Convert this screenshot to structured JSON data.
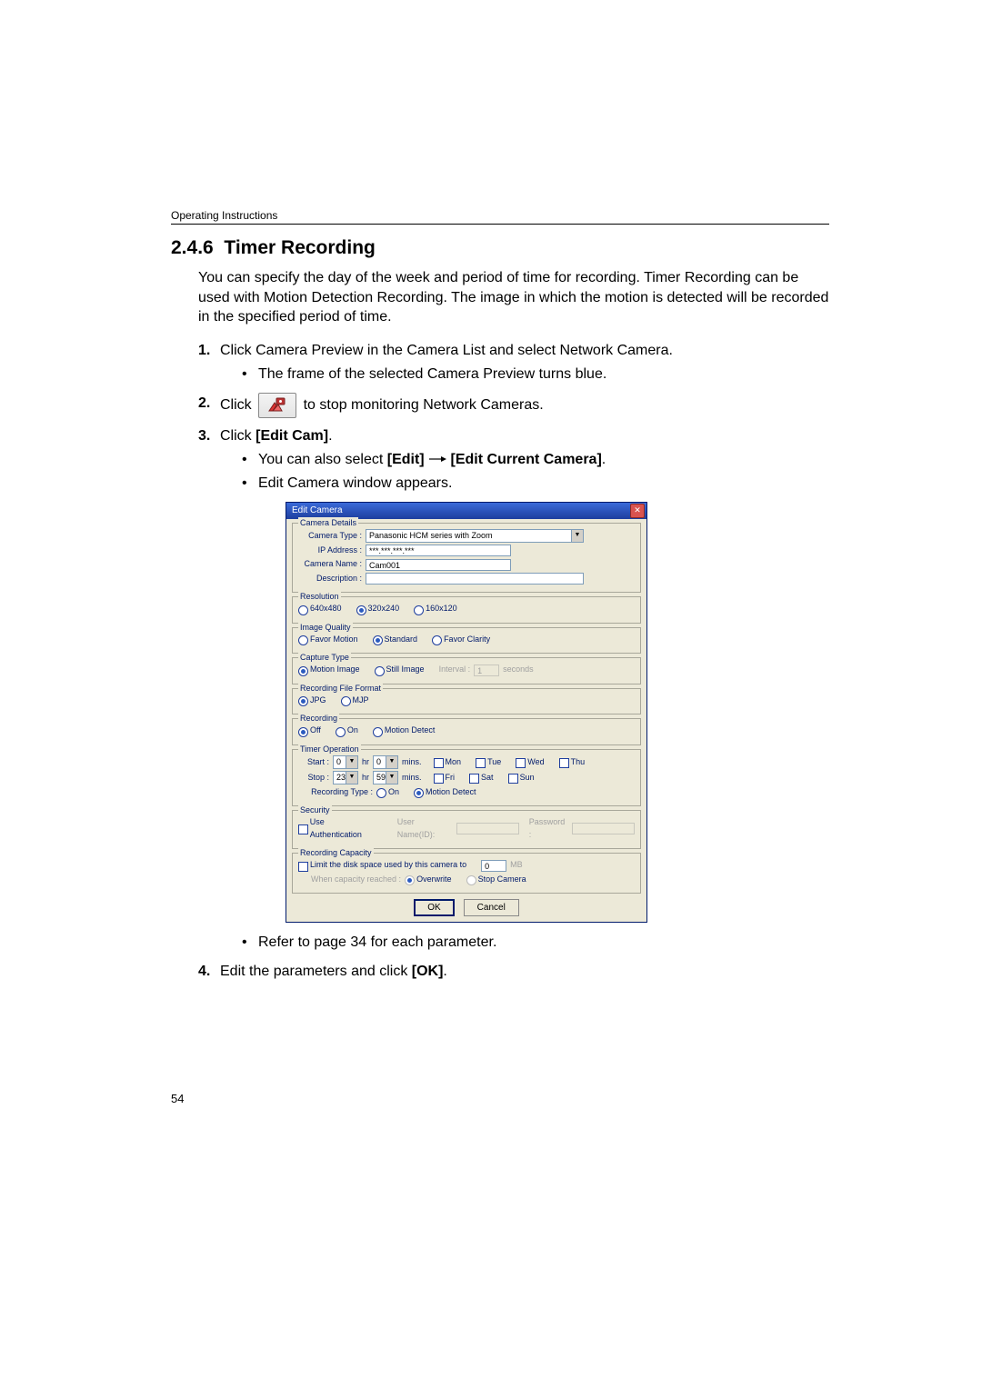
{
  "running_head": "Operating Instructions",
  "section_number": "2.4.6",
  "section_title": "Timer Recording",
  "intro": "You can specify the day of the week and period of time for recording. Timer Recording can be used with Motion Detection Recording. The image in which the motion is detected will be recorded in the specified period of time.",
  "steps": {
    "s1": "Click Camera Preview in the Camera List and select Network Camera.",
    "s1_sub1": "The frame of the selected Camera Preview turns blue.",
    "s2_pre": "Click",
    "s2_post": "to stop monitoring Network Cameras.",
    "s3_pre": "Click ",
    "s3_bold": "[Edit Cam]",
    "s3_post": ".",
    "s3_sub1_pre": "You can also select ",
    "s3_sub1_b1": "[Edit]",
    "s3_sub1_mid": " ",
    "s3_sub1_b2": "[Edit Current Camera]",
    "s3_sub1_post": ".",
    "s3_sub2": "Edit Camera window appears.",
    "s3_sub3_pre": "Refer to page ",
    "s3_sub3_page": "34",
    "s3_sub3_post": " for each parameter.",
    "s4_pre": "Edit the parameters and click ",
    "s4_bold": "[OK]",
    "s4_post": "."
  },
  "dialog": {
    "title": "Edit Camera",
    "grp_details": "Camera Details",
    "lbl_type": "Camera Type :",
    "val_type": "Panasonic HCM series with Zoom",
    "lbl_ip": "IP Address :",
    "val_ip": "***.***.***.***",
    "lbl_name": "Camera Name :",
    "val_name": "Cam001",
    "lbl_desc": "Description :",
    "val_desc": "",
    "grp_res": "Resolution",
    "res1": "640x480",
    "res2": "320x240",
    "res3": "160x120",
    "grp_iq": "Image Quality",
    "iq1": "Favor Motion",
    "iq2": "Standard",
    "iq3": "Favor Clarity",
    "grp_ct": "Capture Type",
    "ct1": "Motion Image",
    "ct2": "Still Image",
    "ct_interval_lbl": "Interval :",
    "ct_interval_val": "1",
    "ct_seconds": "seconds",
    "grp_rff": "Recording File Format",
    "rff1": "JPG",
    "rff2": "MJP",
    "grp_rec": "Recording",
    "rec1": "Off",
    "rec2": "On",
    "rec3": "Motion Detect",
    "grp_to": "Timer Operation",
    "to_start": "Start :",
    "to_stop": "Stop :",
    "to_start_h": "0",
    "to_start_m": "0",
    "to_stop_h": "23",
    "to_stop_m": "59",
    "to_hr": "hr",
    "to_mins": "mins.",
    "d_mon": "Mon",
    "d_tue": "Tue",
    "d_wed": "Wed",
    "d_thu": "Thu",
    "d_fri": "Fri",
    "d_sat": "Sat",
    "d_sun": "Sun",
    "to_rectype": "Recording Type :",
    "to_rt1": "On",
    "to_rt2": "Motion Detect",
    "grp_sec": "Security",
    "sec_auth": "Use Authentication",
    "sec_user_lbl": "User Name(ID):",
    "sec_pass_lbl": "Password :",
    "grp_rc": "Recording Capacity",
    "rc_limit_pre": "Limit the disk space used by this camera to",
    "rc_limit_val": "0",
    "rc_mb": "MB",
    "rc_when": "When capacity reached :",
    "rc_opt1": "Overwrite",
    "rc_opt2": "Stop Camera",
    "btn_ok": "OK",
    "btn_cancel": "Cancel"
  },
  "page_number": "54"
}
